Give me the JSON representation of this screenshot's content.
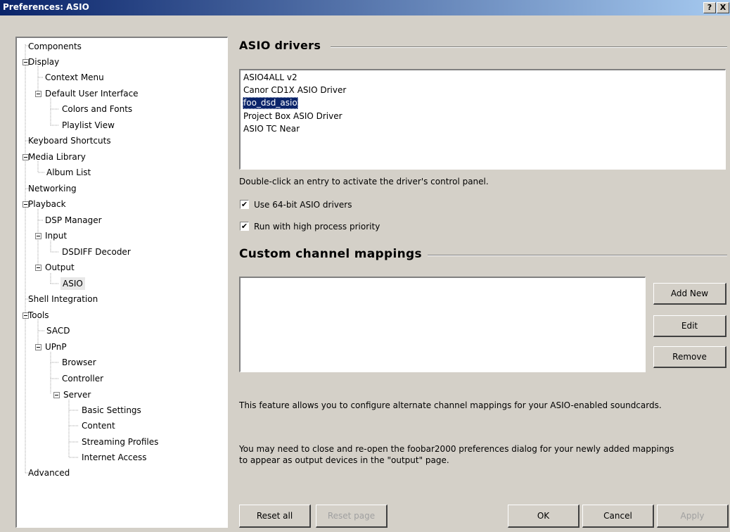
{
  "window": {
    "title": "Preferences: ASIO",
    "help_label": "?",
    "close_label": "X"
  },
  "tree": [
    "Components",
    "Display",
    "Context Menu",
    "Default User Interface",
    "Colors and Fonts",
    "Playlist View",
    "Keyboard Shortcuts",
    "Media Library",
    "Album List",
    "Networking",
    "Playback",
    "DSP Manager",
    "Input",
    "DSDIFF Decoder",
    "Output",
    "ASIO",
    "Shell Integration",
    "Tools",
    "SACD",
    "UPnP",
    "Browser",
    "Controller",
    "Server",
    "Basic Settings",
    "Content",
    "Streaming Profiles",
    "Internet Access",
    "Advanced"
  ],
  "asio": {
    "header": "ASIO drivers",
    "drivers": [
      "ASIO4ALL v2",
      "Canor CD1X ASIO Driver",
      "foo_dsd_asio",
      "Project Box ASIO Driver",
      "ASIO TC Near"
    ],
    "selected_driver": "foo_dsd_asio",
    "hint": "Double-click an entry to activate the driver's control panel.",
    "use64_label": "Use 64-bit ASIO drivers",
    "use64_checked": true,
    "priority_label": "Run with high process priority",
    "priority_checked": true
  },
  "mappings": {
    "header": "Custom channel mappings",
    "add_label": "Add New",
    "edit_label": "Edit",
    "remove_label": "Remove",
    "desc1": "This feature allows you to configure alternate channel mappings for your ASIO-enabled soundcards.",
    "desc2": "You may need to close and re-open the foobar2000 preferences dialog for your newly added mappings to appear as output devices in the \"output\" page."
  },
  "footer": {
    "reset_all": "Reset all",
    "reset_page": "Reset page",
    "ok": "OK",
    "cancel": "Cancel",
    "apply": "Apply"
  },
  "check_glyph": "✔"
}
